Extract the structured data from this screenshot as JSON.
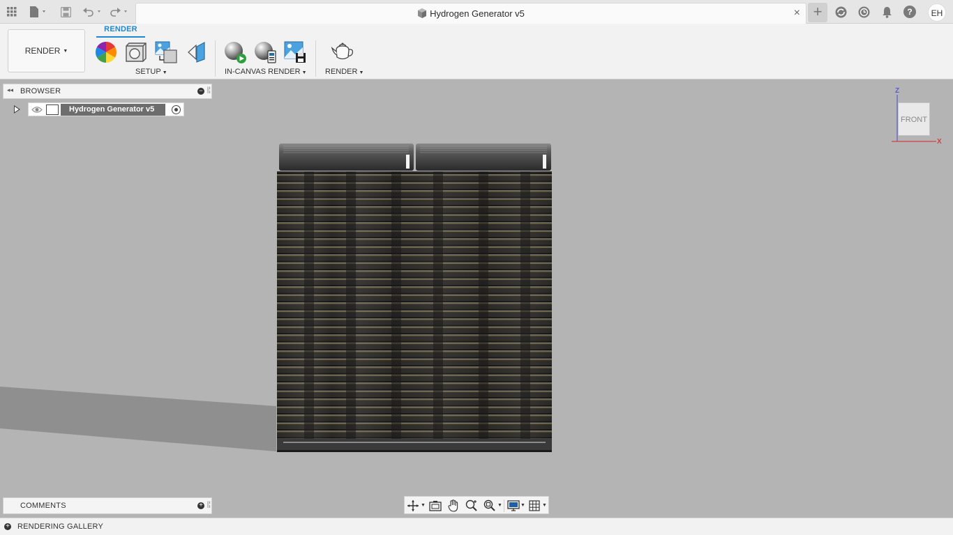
{
  "document": {
    "title": "Hydrogen Generator v5",
    "close_glyph": "×",
    "new_tab_glyph": "+",
    "user_initials": "EH"
  },
  "toolbar_top": {
    "icons": [
      "apps-grid-icon",
      "file-icon",
      "save-icon",
      "undo-icon",
      "redo-icon",
      "extensions-icon",
      "job-status-icon",
      "notifications-icon",
      "help-icon"
    ]
  },
  "ribbon": {
    "workspace_label": "RENDER",
    "active_tab": "RENDER",
    "groups": [
      {
        "label": "SETUP",
        "tools": [
          "appearance-icon",
          "scene-settings-icon",
          "decal-icon",
          "texture-map-icon"
        ]
      },
      {
        "label": "IN-CANVAS RENDER",
        "tools": [
          "in-canvas-render-icon",
          "in-canvas-settings-icon",
          "capture-image-icon"
        ]
      },
      {
        "label": "RENDER",
        "tools": [
          "render-teapot-icon"
        ]
      }
    ],
    "caret": "▼"
  },
  "browser": {
    "title": "BROWSER",
    "root_item": "Hydrogen Generator v5"
  },
  "viewcube": {
    "face": "FRONT",
    "axis_z": "Z",
    "axis_x": "X"
  },
  "comments": {
    "title": "COMMENTS"
  },
  "bottom": {
    "title": "RENDERING GALLERY"
  },
  "colors": {
    "accent": "#1e88d2",
    "viewport_bg": "#b4b4b4",
    "panel_bg": "#f4f4f4"
  }
}
